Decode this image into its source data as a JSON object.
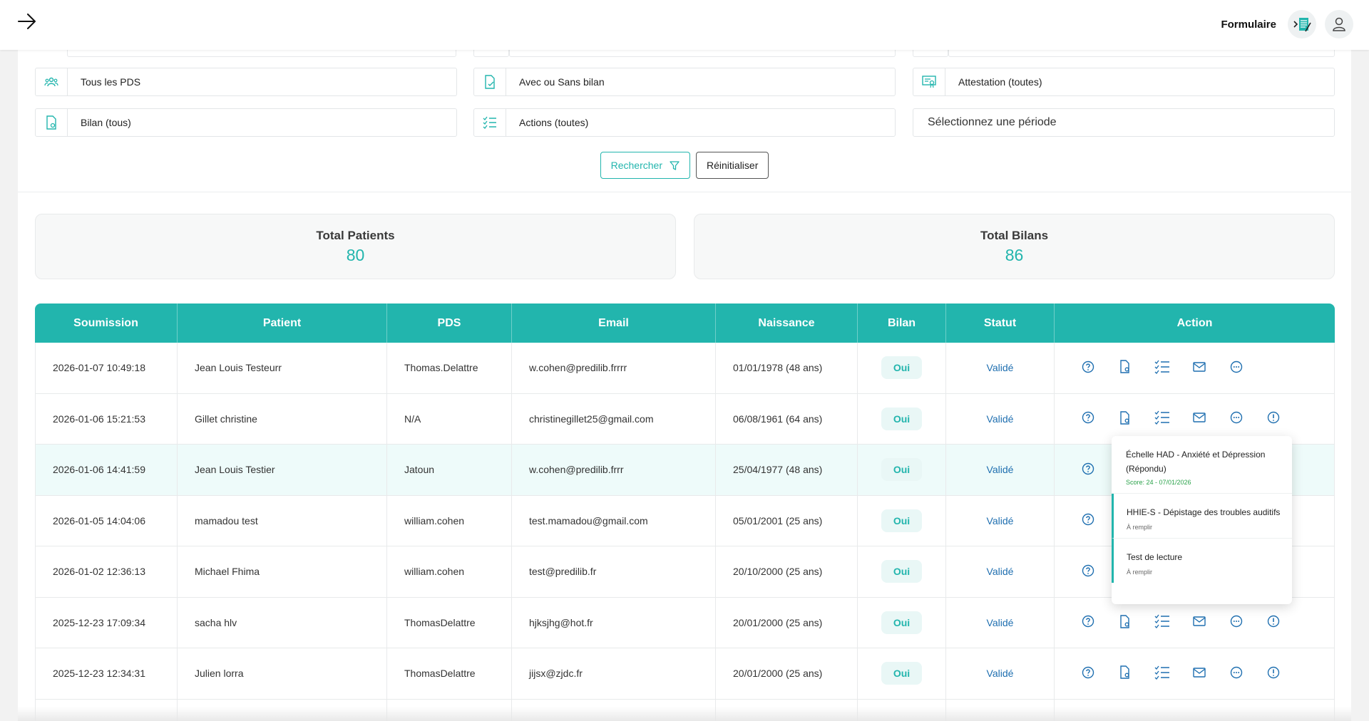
{
  "header": {
    "title": "Formulaire"
  },
  "filters": {
    "pds": "Tous les PDS",
    "bilan_presence": "Avec ou Sans bilan",
    "attestation": "Attestation (toutes)",
    "bilan": "Bilan (tous)",
    "actions": "Actions (toutes)",
    "period": "Sélectionnez une période"
  },
  "buttons": {
    "search": "Rechercher",
    "reset": "Réinitialiser"
  },
  "stats": {
    "patients": {
      "title": "Total Patients",
      "value": "80"
    },
    "bilans": {
      "title": "Total Bilans",
      "value": "86"
    }
  },
  "table": {
    "headers": [
      "Soumission",
      "Patient",
      "PDS",
      "Email",
      "Naissance",
      "Bilan",
      "Statut",
      "Action"
    ],
    "rows": [
      {
        "submission": "2026-01-07 10:49:18",
        "patient": "Jean Louis Testeurr",
        "pds": "Thomas.Delattre",
        "email": "w.cohen@predilib.frrrr",
        "birth": "01/01/1978 (48 ans)",
        "bilan": "Oui",
        "status": "Validé"
      },
      {
        "submission": "2026-01-06 15:21:53",
        "patient": "Gillet christine",
        "pds": "N/A",
        "email": "christinegillet25@gmail.com",
        "birth": "06/08/1961 (64 ans)",
        "bilan": "Oui",
        "status": "Validé"
      },
      {
        "submission": "2026-01-06 14:41:59",
        "patient": "Jean Louis Testier",
        "pds": "Jatoun",
        "email": "w.cohen@predilib.frrr",
        "birth": "25/04/1977 (48 ans)",
        "bilan": "Oui",
        "status": "Validé"
      },
      {
        "submission": "2026-01-05 14:04:06",
        "patient": "mamadou test",
        "pds": "william.cohen",
        "email": "test.mamadou@gmail.com",
        "birth": "05/01/2001 (25 ans)",
        "bilan": "Oui",
        "status": "Validé"
      },
      {
        "submission": "2026-01-02 12:36:13",
        "patient": "Michael Fhima",
        "pds": "william.cohen",
        "email": "test@predilib.fr",
        "birth": "20/10/2000 (25 ans)",
        "bilan": "Oui",
        "status": "Validé"
      },
      {
        "submission": "2025-12-23 17:09:34",
        "patient": "sacha hlv",
        "pds": "ThomasDelattre",
        "email": "hjksjhg@hot.fr",
        "birth": "20/01/2000 (25 ans)",
        "bilan": "Oui",
        "status": "Validé"
      },
      {
        "submission": "2025-12-23 12:34:31",
        "patient": "Julien lorra",
        "pds": "ThomasDelattre",
        "email": "jijsx@zjdc.fr",
        "birth": "20/01/2000 (25 ans)",
        "bilan": "Oui",
        "status": "Validé"
      }
    ]
  },
  "popover": {
    "items": [
      {
        "title": "Échelle HAD - Anxiété et Dépression (Répondu)",
        "score": "Score: 24 - 07/01/2026"
      },
      {
        "title": "HHIE-S - Dépistage des troubles auditifs",
        "state": "À remplir"
      },
      {
        "title": "Test de lecture",
        "state": "À remplir"
      }
    ]
  },
  "colors": {
    "accent": "#22b5ad",
    "status": "#1f6fb0",
    "score": "#2aa24a"
  }
}
